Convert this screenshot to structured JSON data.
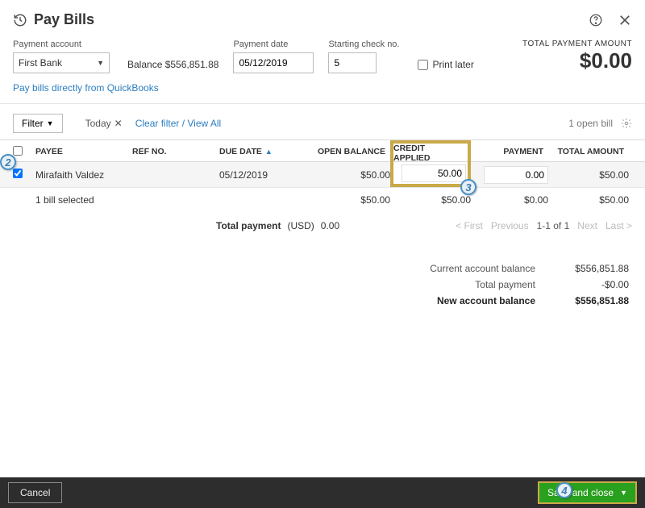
{
  "header": {
    "title": "Pay Bills"
  },
  "form": {
    "payment_account_label": "Payment account",
    "payment_account_value": "First Bank",
    "balance_text": "Balance $556,851.88",
    "payment_date_label": "Payment date",
    "payment_date_value": "05/12/2019",
    "starting_check_label": "Starting check no.",
    "starting_check_value": "5",
    "print_later_label": "Print later"
  },
  "totals_header": {
    "label": "TOTAL PAYMENT AMOUNT",
    "amount": "$0.00"
  },
  "link_text": "Pay bills directly from QuickBooks",
  "filter": {
    "button": "Filter",
    "today": "Today",
    "clear": "Clear filter / View All",
    "open_bills": "1 open bill"
  },
  "columns": {
    "payee": "PAYEE",
    "refno": "REF NO.",
    "duedate": "DUE DATE",
    "openbal": "OPEN BALANCE",
    "credit": "CREDIT APPLIED",
    "payment": "PAYMENT",
    "total": "TOTAL AMOUNT"
  },
  "row": {
    "payee": "Mirafaith Valdez",
    "refno": "",
    "duedate": "05/12/2019",
    "openbal": "$50.00",
    "credit": "50.00",
    "payment": "0.00",
    "total": "$50.00"
  },
  "selected_row": {
    "label": "1 bill selected",
    "openbal": "$50.00",
    "credit": "$50.00",
    "payment": "$0.00",
    "total": "$50.00"
  },
  "total_payment": {
    "label": "Total payment",
    "currency": "(USD)",
    "amount": "0.00"
  },
  "pager": {
    "first": "< First",
    "prev": "Previous",
    "current": "1-1 of 1",
    "next": "Next",
    "last": "Last >"
  },
  "balances": {
    "current_label": "Current account balance",
    "current_value": "$556,851.88",
    "totalpay_label": "Total payment",
    "totalpay_value": "-$0.00",
    "new_label": "New account balance",
    "new_value": "$556,851.88"
  },
  "footer": {
    "cancel": "Cancel",
    "save": "Save and close"
  },
  "callouts": {
    "two": "2",
    "three": "3",
    "four": "4"
  }
}
